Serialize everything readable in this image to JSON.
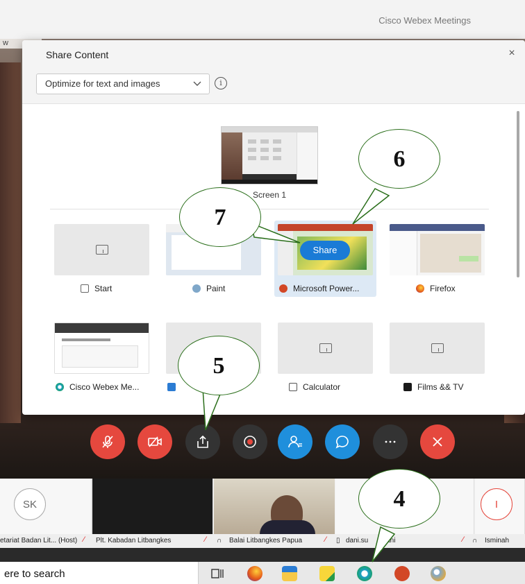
{
  "window": {
    "app_title": "Cisco Webex Meetings",
    "ribbon_text": "w"
  },
  "dialog": {
    "title": "Share Content",
    "close_label": "×",
    "optimize_select": {
      "value": "Optimize for text and images"
    },
    "info_icon": "i",
    "screen_label": "Screen 1",
    "share_button": "Share",
    "apps": [
      {
        "label": "Start",
        "icon": "window-icon"
      },
      {
        "label": "Paint",
        "icon": "paint-icon"
      },
      {
        "label": "Microsoft Power...",
        "icon": "powerpoint-icon"
      },
      {
        "label": "Firefox",
        "icon": "firefox-icon"
      },
      {
        "label": "Cisco Webex Me...",
        "icon": "webex-icon"
      },
      {
        "label": "",
        "icon": "app-icon"
      },
      {
        "label": "Calculator",
        "icon": "calculator-icon"
      },
      {
        "label": "Films && TV",
        "icon": "films-tv-icon"
      }
    ]
  },
  "callouts": {
    "c4": "4",
    "c5": "5",
    "c6": "6",
    "c7": "7"
  },
  "controls": [
    {
      "name": "mute-button",
      "icon": "mic-off-icon",
      "color": "#e5483e"
    },
    {
      "name": "stop-video-button",
      "icon": "video-off-icon",
      "color": "#e5483e"
    },
    {
      "name": "share-content-button",
      "icon": "share-icon",
      "color": "#333333"
    },
    {
      "name": "record-button",
      "icon": "record-icon",
      "color": "#333333"
    },
    {
      "name": "participants-button",
      "icon": "participants-icon",
      "color": "#1f8fdc"
    },
    {
      "name": "chat-button",
      "icon": "chat-icon",
      "color": "#1f8fdc"
    },
    {
      "name": "more-button",
      "icon": "more-icon",
      "color": "#333333"
    },
    {
      "name": "leave-button",
      "icon": "close-icon",
      "color": "#e5483e"
    }
  ],
  "participants": {
    "sk_initials": "SK",
    "i_initial": "I",
    "names": [
      "etariat Badan Lit... (Host)",
      "Plt. Kabadan Litbangkes",
      "Balai Litbangkes Papua",
      "dani.su",
      "ndani",
      "Isminah"
    ]
  },
  "taskbar": {
    "search_text": "ere to search"
  },
  "colors": {
    "accent": "#1a7bd6",
    "danger": "#e5483e",
    "callout_border": "#2a6e1a"
  }
}
